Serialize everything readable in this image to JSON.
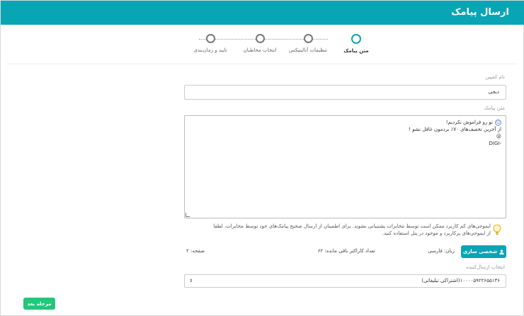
{
  "header": {
    "title": "ارسال پیامک"
  },
  "steps": [
    {
      "label": "متن پیامک",
      "active": true
    },
    {
      "label": "تنظیمات آنالیتیکس",
      "active": false
    },
    {
      "label": "انتخاب مخاطبان",
      "active": false
    },
    {
      "label": "تایید و زمان‌بندی",
      "active": false
    }
  ],
  "campaign": {
    "label": "نام کمپین",
    "value": "دیجی"
  },
  "message": {
    "label": "متن پیامک",
    "lines": [
      "تو رو فراموش نکردیم!",
      "از آخرین تخفیف‌های ۷۰٪ بردمون غافل نشو !",
      "😜",
      "-DIGI"
    ]
  },
  "notice": "ایموجی‌های کم کاربرد ممکن است توسط مخابرات پشتیبانی نشوند. برای اطمینان از ارسال صحیح پیامک‌های خود توسط مخابرات، لطفا از ایموجی‌های پرکاربرد و موجود در پنل استفاده کنید.",
  "toolbar": {
    "customize_label": "شخصی سازی",
    "language": "زبان: فارسی",
    "remaining": "تعداد کاراکتر باقی مانده: ۶۲",
    "pages": "صفحه: ۲"
  },
  "sender": {
    "label": "انتخاب ارسال‌کننده",
    "value": "۱۰۰۰۰۵۹۲۲۶۵۵۱۳۶(اشتراکی تبلیغاتی)"
  },
  "next_button": "مرحله بعد",
  "colors": {
    "accent": "#0aa5b5",
    "success": "#22c77a"
  }
}
